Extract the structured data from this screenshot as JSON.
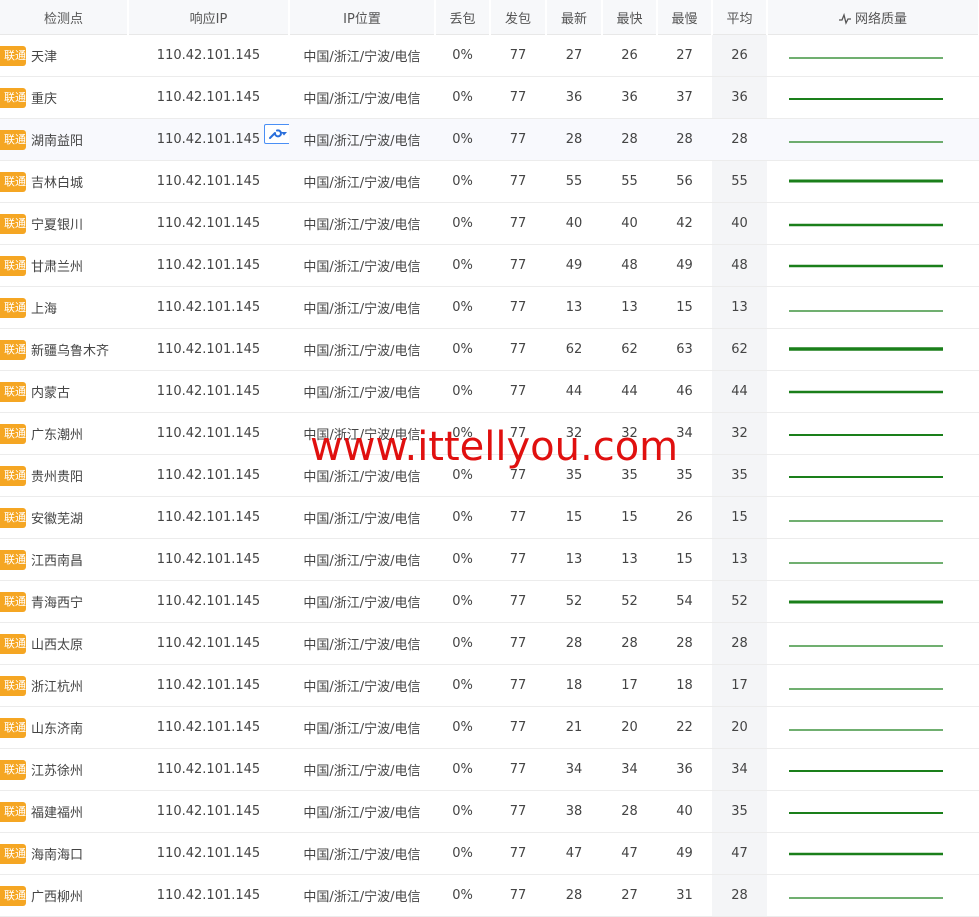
{
  "columns": {
    "node": "检测点",
    "ip": "响应IP",
    "location": "IP位置",
    "loss": "丢包",
    "sent": "发包",
    "latest": "最新",
    "fastest": "最快",
    "slowest": "最慢",
    "avg": "平均",
    "quality": "网络质量"
  },
  "colors": {
    "isp_badge": "#f5a623",
    "spark": "#1a7f1a",
    "watermark": "#e0100f",
    "tool_border": "#4a8ff5"
  },
  "watermark": "www.ittellyou.com",
  "rows": [
    {
      "isp": "联通",
      "city": "天津",
      "ip": "110.42.101.145",
      "location": "中国/浙江/宁波/电信",
      "loss": "0%",
      "sent": "77",
      "latest": "27",
      "fastest": "26",
      "slowest": "27",
      "avg": "26"
    },
    {
      "isp": "联通",
      "city": "重庆",
      "ip": "110.42.101.145",
      "location": "中国/浙江/宁波/电信",
      "loss": "0%",
      "sent": "77",
      "latest": "36",
      "fastest": "36",
      "slowest": "37",
      "avg": "36"
    },
    {
      "isp": "联通",
      "city": "湖南益阳",
      "ip": "110.42.101.145",
      "location": "中国/浙江/宁波/电信",
      "loss": "0%",
      "sent": "77",
      "latest": "28",
      "fastest": "28",
      "slowest": "28",
      "avg": "28"
    },
    {
      "isp": "联通",
      "city": "吉林白城",
      "ip": "110.42.101.145",
      "location": "中国/浙江/宁波/电信",
      "loss": "0%",
      "sent": "77",
      "latest": "55",
      "fastest": "55",
      "slowest": "56",
      "avg": "55"
    },
    {
      "isp": "联通",
      "city": "宁夏银川",
      "ip": "110.42.101.145",
      "location": "中国/浙江/宁波/电信",
      "loss": "0%",
      "sent": "77",
      "latest": "40",
      "fastest": "40",
      "slowest": "42",
      "avg": "40"
    },
    {
      "isp": "联通",
      "city": "甘肃兰州",
      "ip": "110.42.101.145",
      "location": "中国/浙江/宁波/电信",
      "loss": "0%",
      "sent": "77",
      "latest": "49",
      "fastest": "48",
      "slowest": "49",
      "avg": "48"
    },
    {
      "isp": "联通",
      "city": "上海",
      "ip": "110.42.101.145",
      "location": "中国/浙江/宁波/电信",
      "loss": "0%",
      "sent": "77",
      "latest": "13",
      "fastest": "13",
      "slowest": "15",
      "avg": "13"
    },
    {
      "isp": "联通",
      "city": "新疆乌鲁木齐",
      "ip": "110.42.101.145",
      "location": "中国/浙江/宁波/电信",
      "loss": "0%",
      "sent": "77",
      "latest": "62",
      "fastest": "62",
      "slowest": "63",
      "avg": "62"
    },
    {
      "isp": "联通",
      "city": "内蒙古",
      "ip": "110.42.101.145",
      "location": "中国/浙江/宁波/电信",
      "loss": "0%",
      "sent": "77",
      "latest": "44",
      "fastest": "44",
      "slowest": "46",
      "avg": "44"
    },
    {
      "isp": "联通",
      "city": "广东潮州",
      "ip": "110.42.101.145",
      "location": "中国/浙江/宁波/电信",
      "loss": "0%",
      "sent": "77",
      "latest": "32",
      "fastest": "32",
      "slowest": "34",
      "avg": "32"
    },
    {
      "isp": "联通",
      "city": "贵州贵阳",
      "ip": "110.42.101.145",
      "location": "中国/浙江/宁波/电信",
      "loss": "0%",
      "sent": "77",
      "latest": "35",
      "fastest": "35",
      "slowest": "35",
      "avg": "35"
    },
    {
      "isp": "联通",
      "city": "安徽芜湖",
      "ip": "110.42.101.145",
      "location": "中国/浙江/宁波/电信",
      "loss": "0%",
      "sent": "77",
      "latest": "15",
      "fastest": "15",
      "slowest": "26",
      "avg": "15"
    },
    {
      "isp": "联通",
      "city": "江西南昌",
      "ip": "110.42.101.145",
      "location": "中国/浙江/宁波/电信",
      "loss": "0%",
      "sent": "77",
      "latest": "13",
      "fastest": "13",
      "slowest": "15",
      "avg": "13"
    },
    {
      "isp": "联通",
      "city": "青海西宁",
      "ip": "110.42.101.145",
      "location": "中国/浙江/宁波/电信",
      "loss": "0%",
      "sent": "77",
      "latest": "52",
      "fastest": "52",
      "slowest": "54",
      "avg": "52"
    },
    {
      "isp": "联通",
      "city": "山西太原",
      "ip": "110.42.101.145",
      "location": "中国/浙江/宁波/电信",
      "loss": "0%",
      "sent": "77",
      "latest": "28",
      "fastest": "28",
      "slowest": "28",
      "avg": "28"
    },
    {
      "isp": "联通",
      "city": "浙江杭州",
      "ip": "110.42.101.145",
      "location": "中国/浙江/宁波/电信",
      "loss": "0%",
      "sent": "77",
      "latest": "18",
      "fastest": "17",
      "slowest": "18",
      "avg": "17"
    },
    {
      "isp": "联通",
      "city": "山东济南",
      "ip": "110.42.101.145",
      "location": "中国/浙江/宁波/电信",
      "loss": "0%",
      "sent": "77",
      "latest": "21",
      "fastest": "20",
      "slowest": "22",
      "avg": "20"
    },
    {
      "isp": "联通",
      "city": "江苏徐州",
      "ip": "110.42.101.145",
      "location": "中国/浙江/宁波/电信",
      "loss": "0%",
      "sent": "77",
      "latest": "34",
      "fastest": "34",
      "slowest": "36",
      "avg": "34"
    },
    {
      "isp": "联通",
      "city": "福建福州",
      "ip": "110.42.101.145",
      "location": "中国/浙江/宁波/电信",
      "loss": "0%",
      "sent": "77",
      "latest": "38",
      "fastest": "28",
      "slowest": "40",
      "avg": "35"
    },
    {
      "isp": "联通",
      "city": "海南海口",
      "ip": "110.42.101.145",
      "location": "中国/浙江/宁波/电信",
      "loss": "0%",
      "sent": "77",
      "latest": "47",
      "fastest": "47",
      "slowest": "49",
      "avg": "47"
    },
    {
      "isp": "联通",
      "city": "广西柳州",
      "ip": "110.42.101.145",
      "location": "中国/浙江/宁波/电信",
      "loss": "0%",
      "sent": "77",
      "latest": "28",
      "fastest": "27",
      "slowest": "31",
      "avg": "28"
    }
  ]
}
